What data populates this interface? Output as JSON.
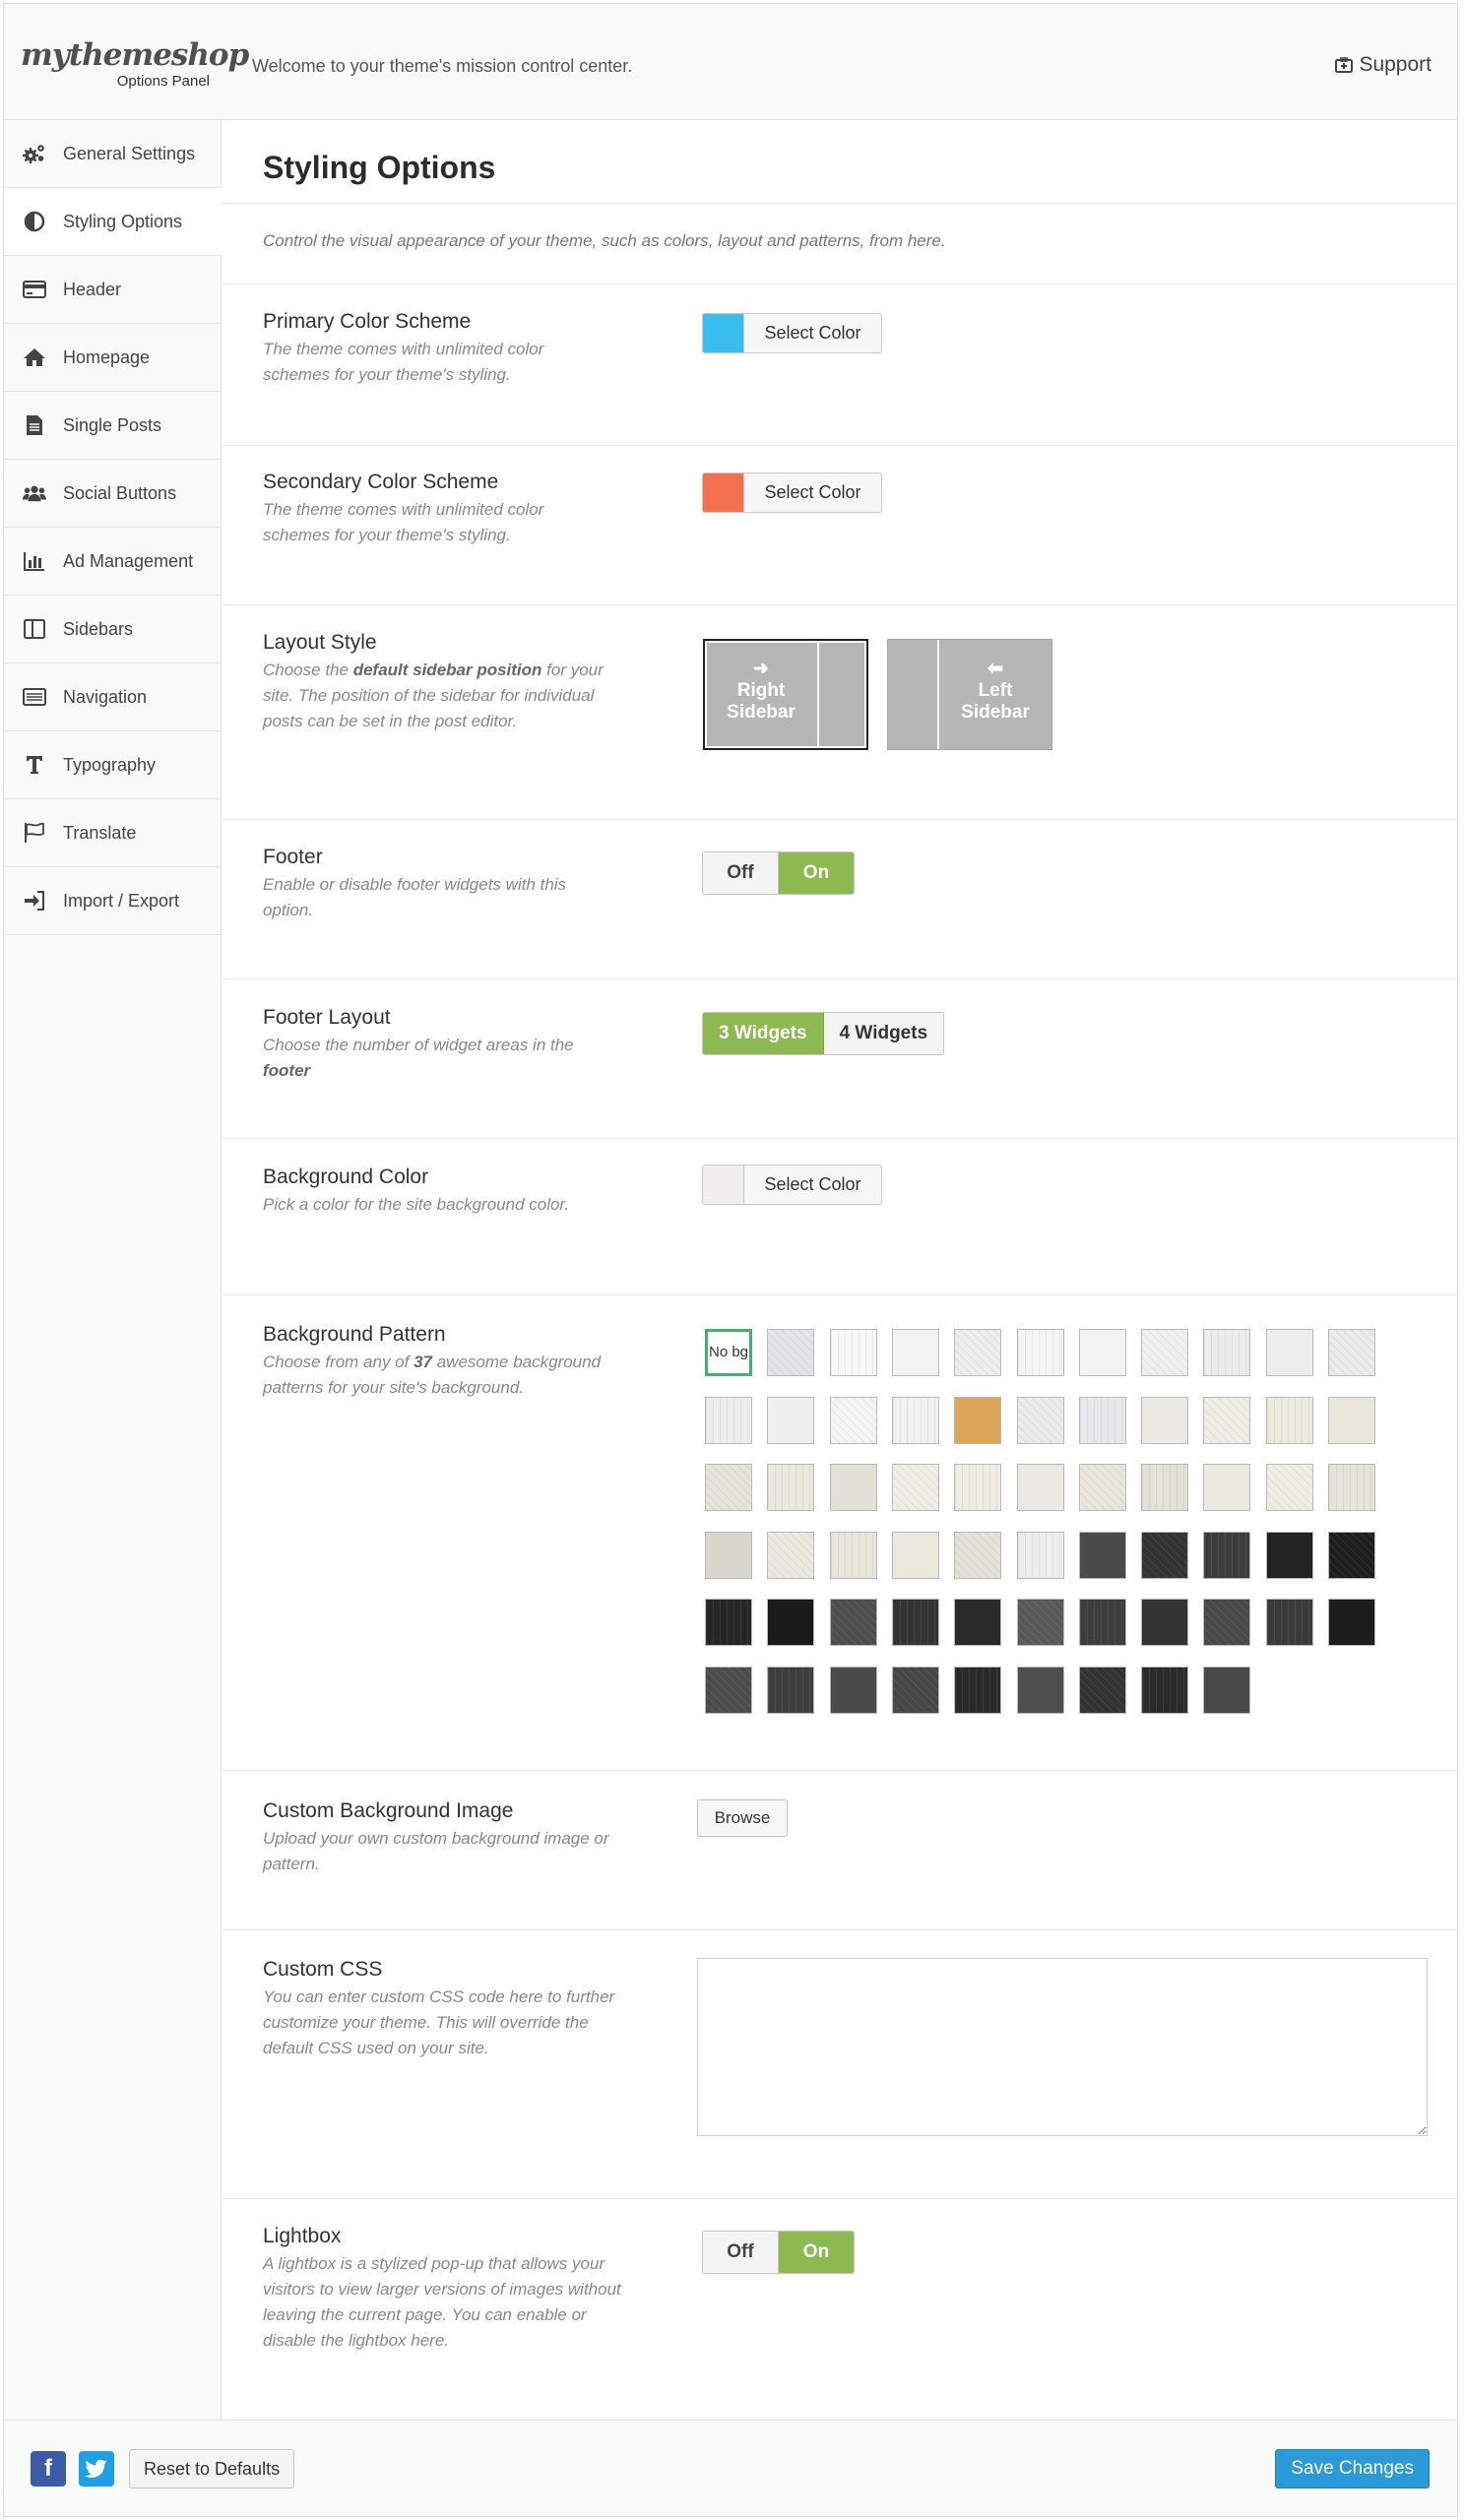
{
  "header": {
    "brand": "mythemeshop",
    "brand_sub": "Options Panel",
    "welcome": "Welcome to your theme's mission control center.",
    "support": "Support"
  },
  "sidebar": {
    "items": [
      {
        "label": "General Settings",
        "icon": "gears-icon"
      },
      {
        "label": "Styling Options",
        "icon": "contrast-icon"
      },
      {
        "label": "Header",
        "icon": "header-card-icon"
      },
      {
        "label": "Homepage",
        "icon": "home-icon"
      },
      {
        "label": "Single Posts",
        "icon": "document-icon"
      },
      {
        "label": "Social Buttons",
        "icon": "users-icon"
      },
      {
        "label": "Ad Management",
        "icon": "bar-chart-icon"
      },
      {
        "label": "Sidebars",
        "icon": "columns-icon"
      },
      {
        "label": "Navigation",
        "icon": "list-icon"
      },
      {
        "label": "Typography",
        "icon": "text-icon"
      },
      {
        "label": "Translate",
        "icon": "flag-icon"
      },
      {
        "label": "Import / Export",
        "icon": "sign-in-icon"
      }
    ],
    "active_index": 1
  },
  "main": {
    "title": "Styling Options",
    "intro": "Control the visual appearance of your theme, such as colors, layout and patterns, from here.",
    "primary": {
      "title": "Primary Color Scheme",
      "desc": "The theme comes with unlimited color schemes for your theme's styling.",
      "button": "Select Color",
      "color": "#38bdf0"
    },
    "secondary": {
      "title": "Secondary Color Scheme",
      "desc": "The theme comes with unlimited color schemes for your theme's styling.",
      "button": "Select Color",
      "color": "#f3714f"
    },
    "layout": {
      "title": "Layout Style",
      "desc_pre": "Choose the ",
      "desc_bold": "default sidebar position",
      "desc_post": " for your site. The position of the sidebar for individual posts can be set in the post editor.",
      "right_arrow": "➜",
      "right_label": "Right Sidebar",
      "left_arrow": "⬅",
      "left_label": "Left Sidebar",
      "selected": "Right Sidebar"
    },
    "footer": {
      "title": "Footer",
      "desc": "Enable or disable footer widgets with this option.",
      "off": "Off",
      "on": "On",
      "value": "On"
    },
    "footer_layout": {
      "title": "Footer Layout",
      "desc_pre": "Choose the number of widget areas in the ",
      "desc_bold": "footer",
      "opt3": "3 Widgets",
      "opt4": "4 Widgets",
      "value": "3 Widgets"
    },
    "bg_color": {
      "title": "Background Color",
      "desc": "Pick a color for the site background color.",
      "button": "Select Color",
      "color": "#f0efeb"
    },
    "bg_pattern": {
      "title": "Background Pattern",
      "desc_pre": "Choose from any of ",
      "desc_bold": "37",
      "desc_mid": " awesome",
      "desc_post": " background patterns for your site's background.",
      "nobg": "No bg",
      "selected": "No bg",
      "swatches": [
        "#e4e4e8",
        "#f8f8f8",
        "#f2f2f2",
        "#ededed",
        "#f5f5f5",
        "#f3f3f3",
        "#f0f0f0",
        "#ececec",
        "#eeeeee",
        "#ebebeb",
        "#eeeeee",
        "#f0f0f0",
        "#f4f4f4",
        "#f1f1f1",
        "#dca55a",
        "#ebebeb",
        "#e9e9ec",
        "#eceae4",
        "#efede6",
        "#eeebe1",
        "#e9e6dc",
        "#e6e3da",
        "#ebe8df",
        "#e4e1d8",
        "#f1eee6",
        "#efece4",
        "#ebe9e3",
        "#e8e5dc",
        "#e4e1d8",
        "#ece9e0",
        "#f0ede4",
        "#e6e3db",
        "#d9d6cd",
        "#ece9e1",
        "#e8e5da",
        "#ebe8de",
        "#e4e1d9",
        "#eeeeee",
        "#4a4a4a",
        "#333333",
        "#3c3c3c",
        "#222222",
        "#1e1e1e",
        "#262626",
        "#1a1a1a",
        "#4d4d4d",
        "#333333",
        "#2a2a2a",
        "#585858",
        "#3c3c3c",
        "#333333",
        "#484848",
        "#3a3a3a",
        "#1c1c1c",
        "#4c4c4c",
        "#3e3e3e",
        "#4a4a4a",
        "#464646",
        "#2a2a2a",
        "#4e4e4e",
        "#333333",
        "#2b2b2b",
        "#494949"
      ]
    },
    "custom_bg": {
      "title": "Custom Background Image",
      "desc": "Upload your own custom background image or pattern.",
      "button": "Browse"
    },
    "custom_css": {
      "title": "Custom CSS",
      "desc": "You can enter custom CSS code here to further customize your theme. This will override the default CSS used on your site.",
      "value": ""
    },
    "lightbox": {
      "title": "Lightbox",
      "desc": "A lightbox is a stylized pop-up that allows your visitors to view larger versions of images without leaving the current page. You can enable or disable the lightbox here.",
      "off": "Off",
      "on": "On",
      "value": "On"
    }
  },
  "footer_bar": {
    "facebook_icon": "facebook-icon",
    "twitter_icon": "twitter-icon",
    "reset": "Reset to Defaults",
    "save": "Save Changes",
    "save_color": "#2a9ad8"
  }
}
